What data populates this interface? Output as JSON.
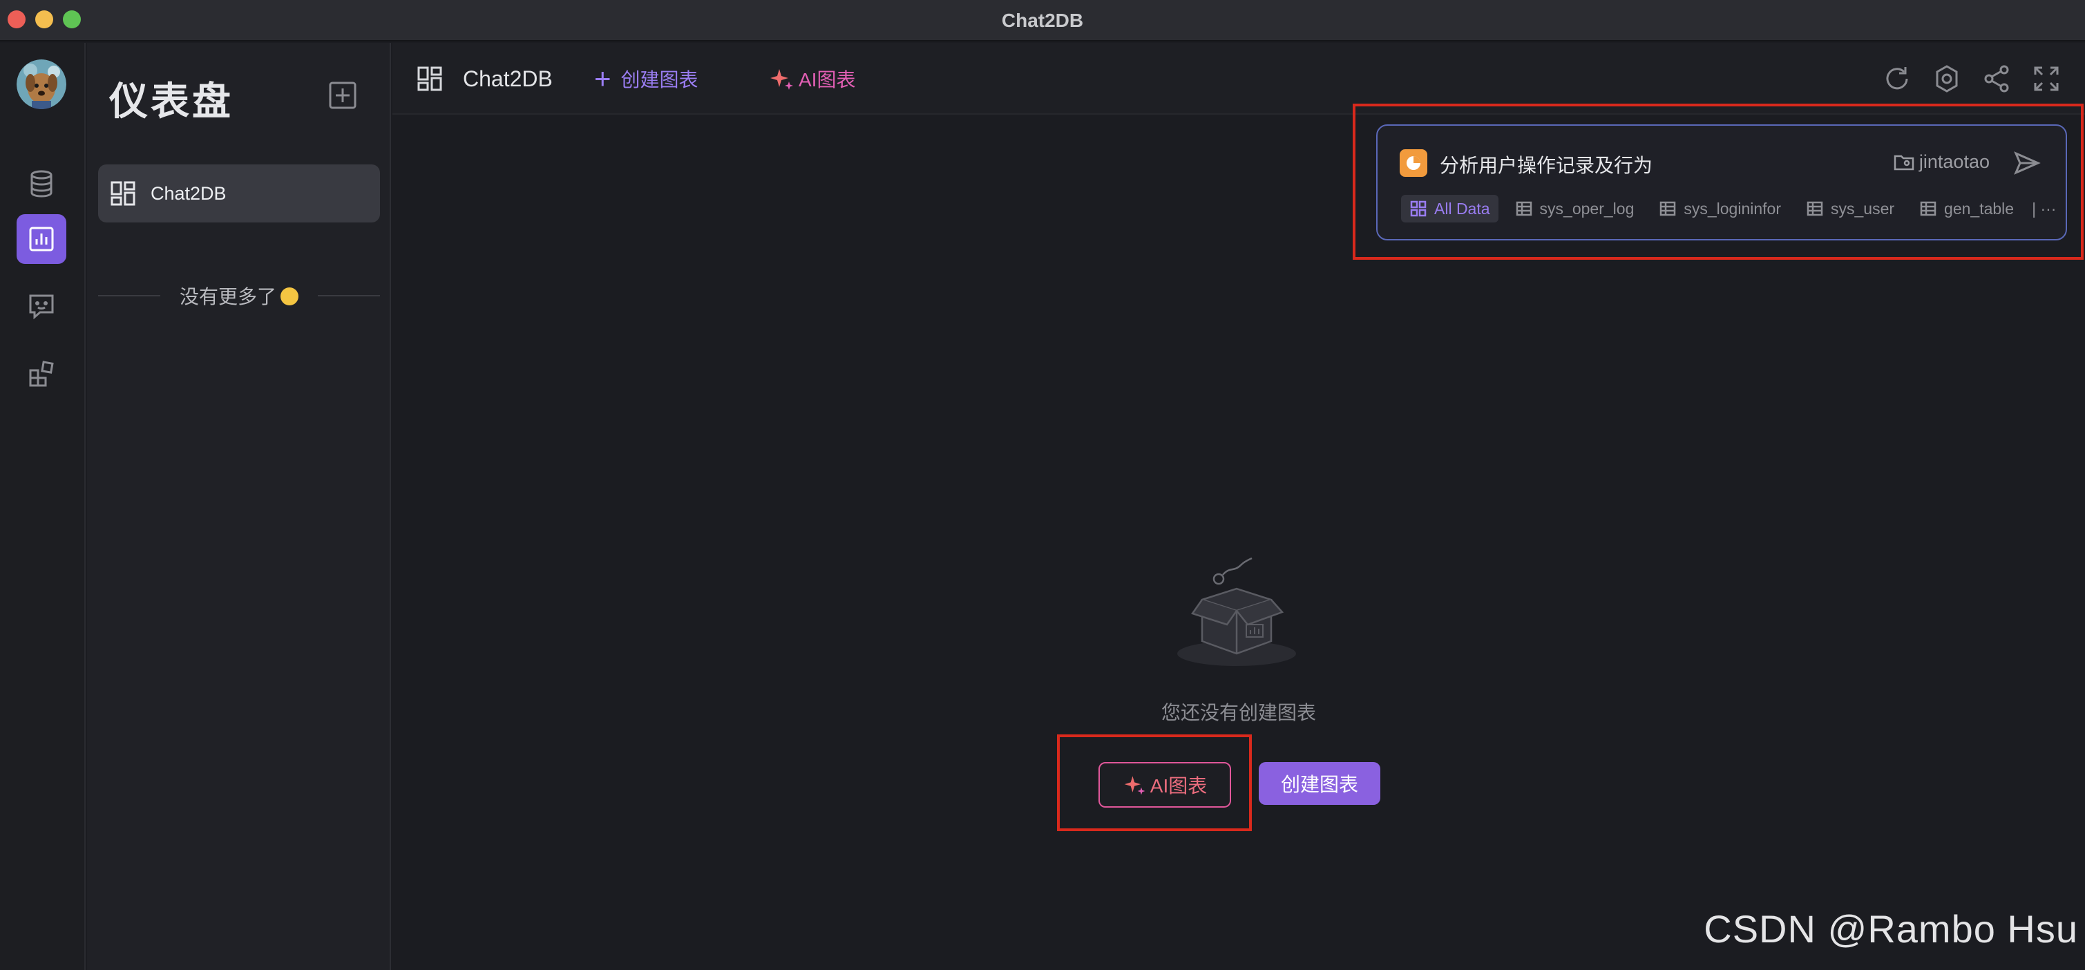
{
  "window": {
    "title": "Chat2DB"
  },
  "rail": {
    "items": [
      {
        "name": "database",
        "icon": "database-icon"
      },
      {
        "name": "dashboard",
        "icon": "chart-icon",
        "active": true
      },
      {
        "name": "chat",
        "icon": "chat-icon"
      },
      {
        "name": "plugins",
        "icon": "blocks-icon"
      }
    ]
  },
  "panel": {
    "title": "仪表盘",
    "items": [
      {
        "label": "Chat2DB"
      }
    ],
    "no_more": "没有更多了"
  },
  "toolbar": {
    "board_name": "Chat2DB",
    "create_chart": "创建图表",
    "ai_chart": "AI图表"
  },
  "ai_input": {
    "prompt": "分析用户操作记录及行为",
    "user": "jintaotao",
    "tables": [
      "All Data",
      "sys_oper_log",
      "sys_logininfor",
      "sys_user",
      "gen_table"
    ],
    "more": "| ···"
  },
  "empty_state": {
    "message": "您还没有创建图表",
    "ai_button": "AI图表",
    "create_button": "创建图表"
  },
  "watermark": "CSDN @Rambo Hsu",
  "colors": {
    "accent": "#8a61e0",
    "highlight": "#d9291c",
    "ai_gradient": "#e0579a"
  }
}
